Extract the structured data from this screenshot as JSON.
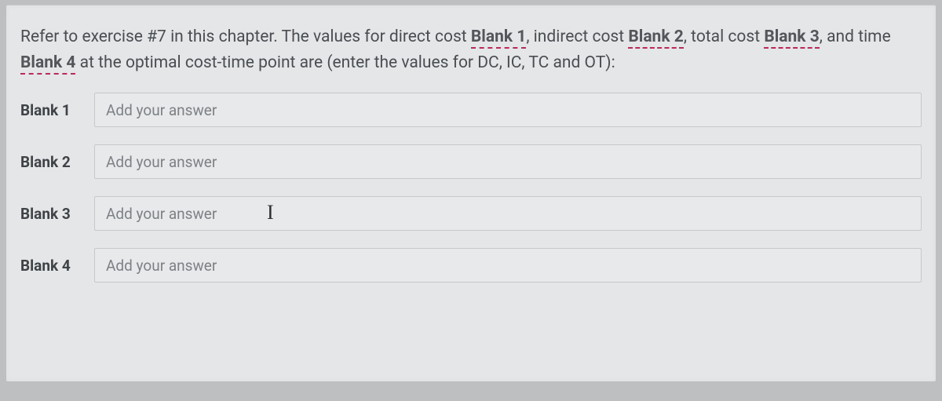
{
  "prompt": {
    "part1": "Refer to exercise #7 in this chapter. The values for direct cost ",
    "blank1": "Blank 1",
    "part2": ", indirect cost ",
    "blank2": "Blank 2",
    "part3": ", total cost ",
    "blank3": "Blank 3",
    "part4": ", and time ",
    "blank4": "Blank 4",
    "part5": " at the optimal cost-time point are (enter the values for DC, IC, TC and OT):"
  },
  "blanks": [
    {
      "label": "Blank 1",
      "placeholder": "Add your answer",
      "value": "",
      "caret": false
    },
    {
      "label": "Blank 2",
      "placeholder": "Add your answer",
      "value": "",
      "caret": false
    },
    {
      "label": "Blank 3",
      "placeholder": "Add your answer",
      "value": "",
      "caret": true
    },
    {
      "label": "Blank 4",
      "placeholder": "Add your answer",
      "value": "",
      "caret": false
    }
  ],
  "caret_glyph": "I"
}
